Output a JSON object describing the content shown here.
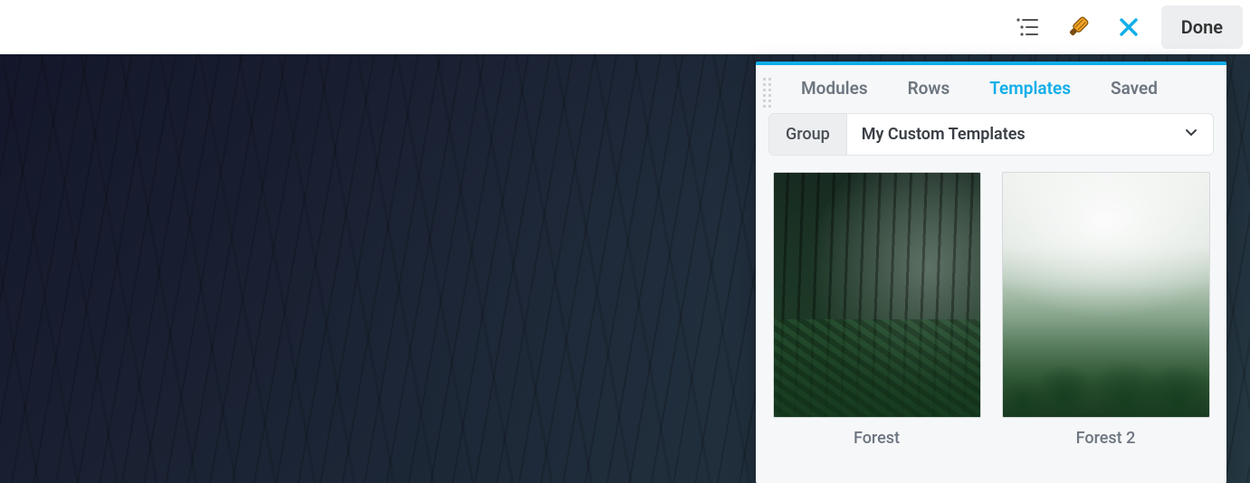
{
  "toolbar": {
    "outline_icon": "list-outline-icon",
    "brush_icon": "paintbrush-icon",
    "close_icon": "close-icon",
    "done_label": "Done"
  },
  "panel": {
    "tabs": [
      {
        "id": "modules",
        "label": "Modules",
        "active": false
      },
      {
        "id": "rows",
        "label": "Rows",
        "active": false
      },
      {
        "id": "templates",
        "label": "Templates",
        "active": true
      },
      {
        "id": "saved",
        "label": "Saved",
        "active": false
      }
    ],
    "group": {
      "label": "Group",
      "selected": "My Custom Templates"
    },
    "templates": [
      {
        "id": "forest",
        "label": "Forest",
        "thumb": "forest1"
      },
      {
        "id": "forest-2",
        "label": "Forest 2",
        "thumb": "forest2"
      }
    ]
  },
  "colors": {
    "accent": "#0faee9",
    "panel_bg": "#f6f7f8",
    "toolbar_button_bg": "#eceef0"
  }
}
